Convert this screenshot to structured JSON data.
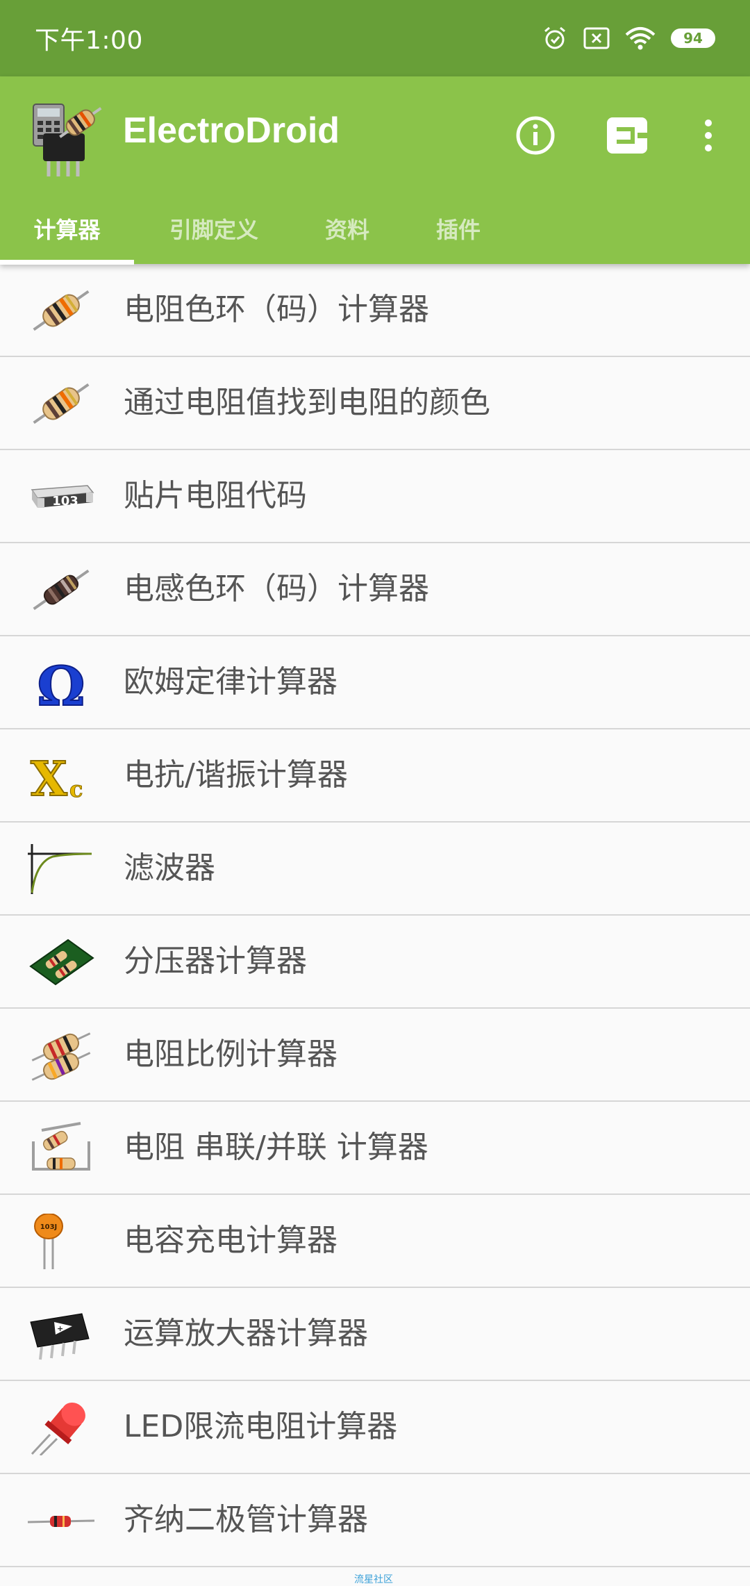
{
  "status_bar": {
    "time": "下午1:00",
    "battery": "94",
    "icons": [
      "alarm-icon",
      "close-box-icon",
      "wifi-icon",
      "battery-icon"
    ]
  },
  "app_bar": {
    "title": "ElectroDroid",
    "actions": [
      "info-icon",
      "connector-icon",
      "more-vert-icon"
    ],
    "colors": {
      "status": "#689f38",
      "toolbar": "#8bc34a"
    }
  },
  "tabs": [
    {
      "label": "计算器",
      "active": true
    },
    {
      "label": "引脚定义",
      "active": false
    },
    {
      "label": "资料",
      "active": false
    },
    {
      "label": "插件",
      "active": false
    }
  ],
  "items": [
    {
      "label": "电阻色环（码）计算器",
      "icon": "resistor-icon"
    },
    {
      "label": "通过电阻值找到电阻的颜色",
      "icon": "resistor-icon"
    },
    {
      "label": "贴片电阻代码",
      "icon": "smd-resistor-icon"
    },
    {
      "label": "电感色环（码）计算器",
      "icon": "inductor-icon"
    },
    {
      "label": "欧姆定律计算器",
      "icon": "ohm-icon"
    },
    {
      "label": "电抗/谐振计算器",
      "icon": "reactance-icon"
    },
    {
      "label": "滤波器",
      "icon": "filter-curve-icon"
    },
    {
      "label": "分压器计算器",
      "icon": "voltage-divider-icon"
    },
    {
      "label": "电阻比例计算器",
      "icon": "resistor-ratio-icon"
    },
    {
      "label": "电阻 串联/并联 计算器",
      "icon": "resistor-network-icon"
    },
    {
      "label": "电容充电计算器",
      "icon": "capacitor-icon"
    },
    {
      "label": "运算放大器计算器",
      "icon": "opamp-icon"
    },
    {
      "label": "LED限流电阻计算器",
      "icon": "led-icon"
    },
    {
      "label": "齐纳二极管计算器",
      "icon": "zener-diode-icon"
    }
  ],
  "smd_code": "103",
  "capacitor_code": "103J",
  "watermark": "流星社区"
}
